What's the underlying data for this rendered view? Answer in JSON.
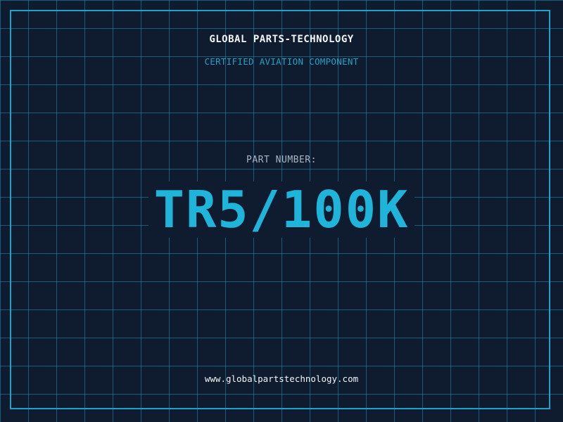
{
  "header": {
    "company": "GLOBAL PARTS-TECHNOLOGY",
    "subtitle": "CERTIFIED AVIATION COMPONENT"
  },
  "main": {
    "part_label": "PART NUMBER:",
    "part_number": "TR5/100K"
  },
  "footer": {
    "website": "www.globalpartstechnology.com"
  },
  "colors": {
    "background": "#0f1b2e",
    "grid": "#1b96b4",
    "accent": "#1fb5da",
    "text_primary": "#f2f5f8",
    "text_muted": "#aab6c4"
  }
}
